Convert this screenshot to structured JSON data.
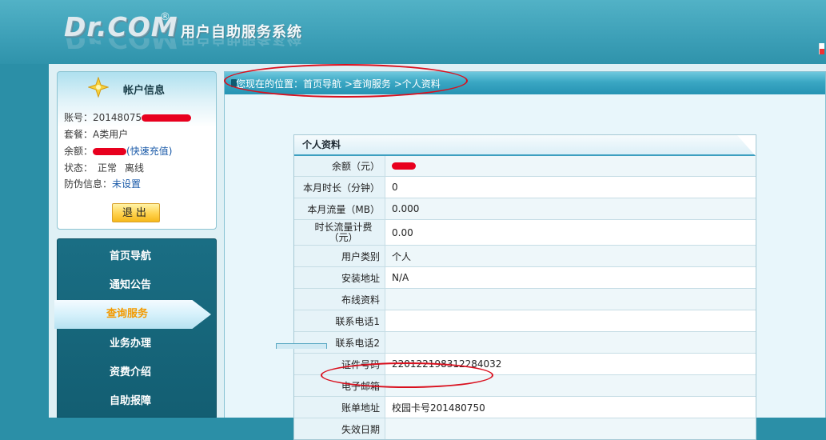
{
  "header": {
    "logo": "Dr.COM",
    "reg": "®",
    "title": "用户自助服务系统"
  },
  "account": {
    "title": "帐户信息",
    "rows": [
      {
        "label": "账号：",
        "value": "20148075"
      },
      {
        "label": "套餐：",
        "value": "A类用户"
      },
      {
        "label": "余额：",
        "link": "(快速充值)"
      },
      {
        "label": "状态：",
        "value": "正常",
        "value2": "离线"
      },
      {
        "label": "防伪信息：",
        "link": "未设置"
      }
    ],
    "logout": "退出"
  },
  "nav": {
    "items": [
      "首页导航",
      "通知公告",
      "查询服务",
      "业务办理",
      "资费介绍",
      "自助报障"
    ],
    "active_index": 2
  },
  "breadcrumb": {
    "prefix": "您现在的位置：",
    "items": [
      "首页导航",
      "查询服务",
      "个人资料"
    ],
    "separator": " >"
  },
  "profile": {
    "title": "个人资料",
    "rows": [
      {
        "label": "余额（元）",
        "value": ""
      },
      {
        "label": "本月时长（分钟）",
        "value": "0"
      },
      {
        "label": "本月流量（MB）",
        "value": "0.000"
      },
      {
        "label": "时长流量计费（元）",
        "value": "0.00"
      },
      {
        "label": "用户类别",
        "value": "个人"
      },
      {
        "label": "安装地址",
        "value": "N/A"
      },
      {
        "label": "布线资料",
        "value": ""
      },
      {
        "label": "联系电话1",
        "value": ""
      },
      {
        "label": "联系电话2",
        "value": ""
      },
      {
        "label": "证件号码",
        "value": "220122198312284032"
      },
      {
        "label": "电子邮箱",
        "value": ""
      },
      {
        "label": "账单地址",
        "value": "校园卡号201480750"
      },
      {
        "label": "失效日期",
        "value": ""
      }
    ]
  },
  "colors": {
    "annotation": "#d9101e",
    "redaction": "#e8001e",
    "active_nav_text": "#f39a00",
    "header": "#3c9fb7"
  }
}
